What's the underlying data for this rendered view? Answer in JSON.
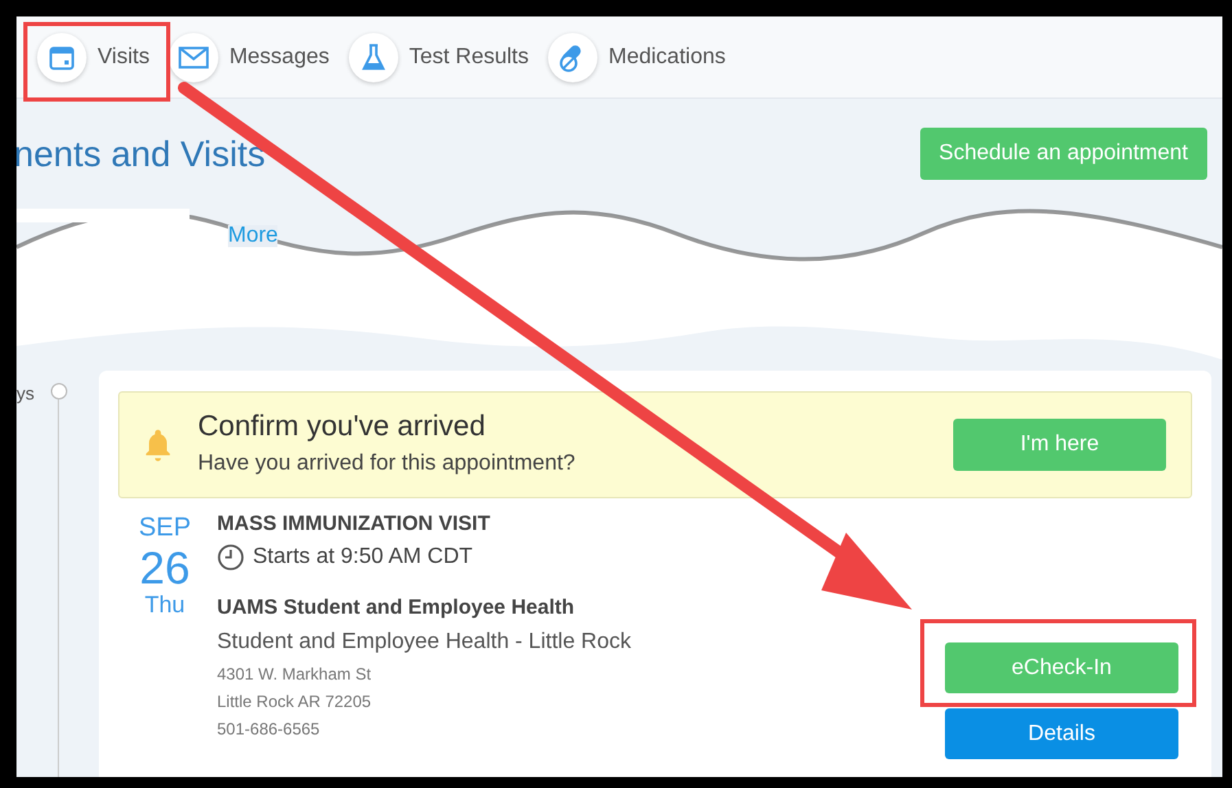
{
  "nav": {
    "items": [
      {
        "label": "Visits",
        "kind": "calendar"
      },
      {
        "label": "Messages",
        "kind": "envelope"
      },
      {
        "label": "Test Results",
        "kind": "flask"
      },
      {
        "label": "Medications",
        "kind": "pills"
      }
    ]
  },
  "page_title": "nents and Visits",
  "schedule_button": "Schedule an appointment",
  "filter_link": "More",
  "timeline_label": "ys",
  "alert": {
    "title": "Confirm you've arrived",
    "message": "Have you arrived for this appointment?",
    "button": "I'm here"
  },
  "appointment": {
    "month": "SEP",
    "day": "26",
    "weekday": "Thu",
    "visit_type": "MASS IMMUNIZATION VISIT",
    "start_time": "Starts at 9:50 AM CDT",
    "department": "UAMS Student and Employee Health",
    "location": "Student and Employee Health - Little Rock",
    "address_lines": [
      "4301 W. Markham St",
      "Little Rock AR 72205",
      "501-686-6565"
    ]
  },
  "actions": [
    {
      "label": "eCheck-In",
      "kind": "primary"
    },
    {
      "label": "Details",
      "kind": "secondary"
    }
  ]
}
